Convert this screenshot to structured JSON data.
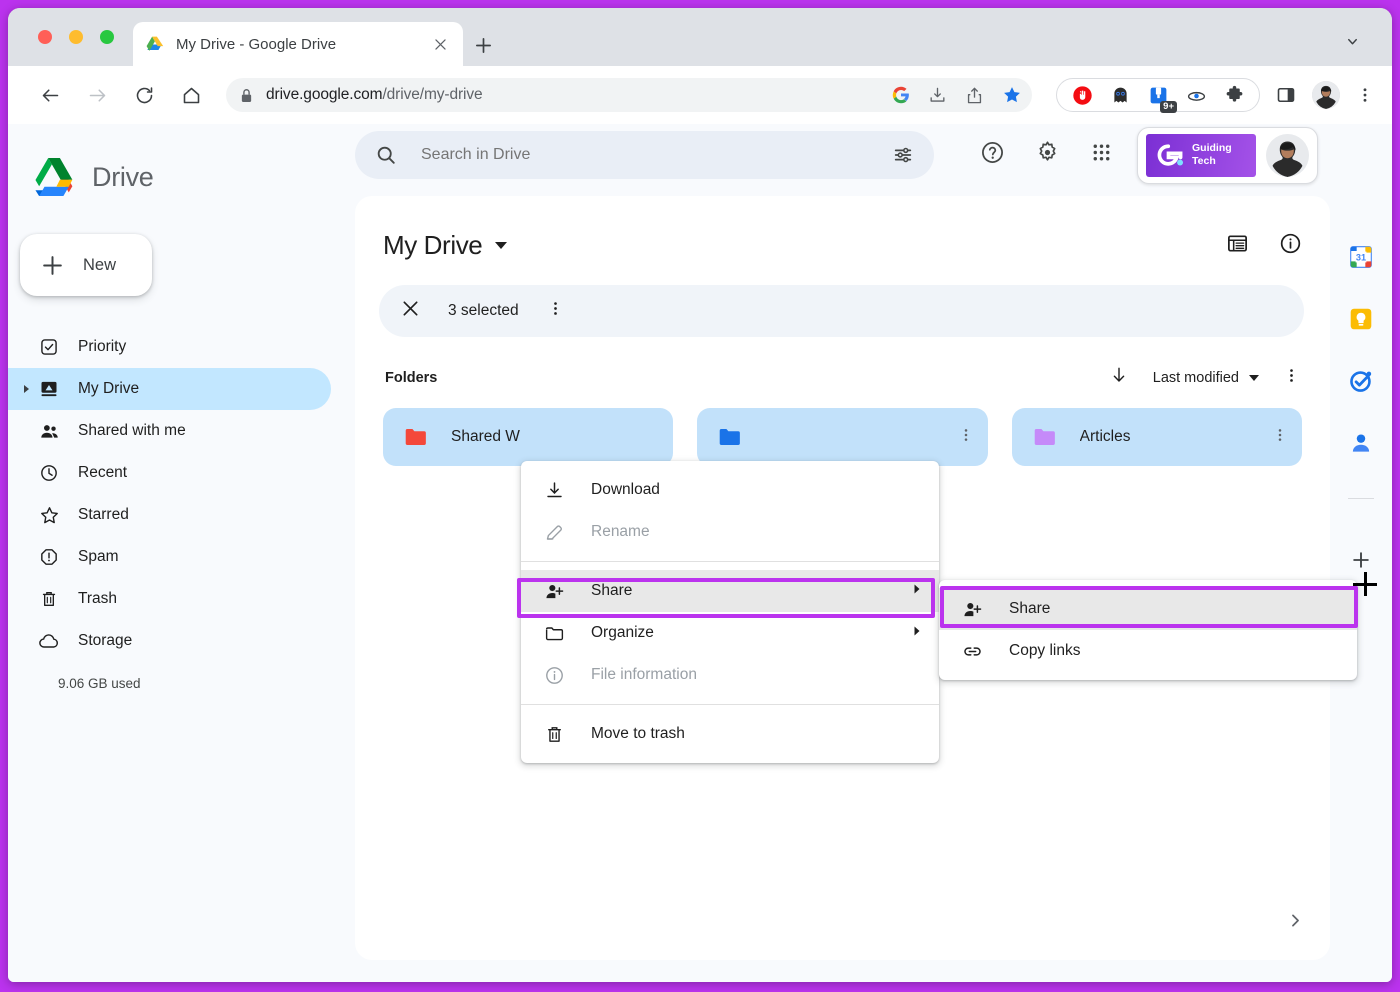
{
  "browser": {
    "tab": {
      "title": "My Drive - Google Drive",
      "favicon": "google-drive-favicon",
      "close": "×"
    },
    "new_tab_label": "+",
    "url": {
      "domain": "drive.google.com",
      "path": "/drive/my-drive"
    },
    "toolbar_icons": [
      "google-icon",
      "install-app-icon",
      "share-icon",
      "bookmark-star-icon"
    ],
    "extensions": [
      "adblock-icon",
      "ghostery-icon",
      "notes-extension-icon",
      "eye-extension-icon",
      "puzzle-extensions-icon"
    ],
    "extension_badge": "9+",
    "right_icons": [
      "side-panel-icon",
      "profile-avatar",
      "chrome-menu-icon"
    ]
  },
  "sidebar": {
    "brand": "Drive",
    "new_button": "New",
    "items": [
      {
        "label": "Priority",
        "icon": "priority-check-icon",
        "active": false
      },
      {
        "label": "My Drive",
        "icon": "my-drive-icon",
        "active": true
      },
      {
        "label": "Shared with me",
        "icon": "shared-people-icon",
        "active": false
      },
      {
        "label": "Recent",
        "icon": "clock-icon",
        "active": false
      },
      {
        "label": "Starred",
        "icon": "star-icon",
        "active": false
      },
      {
        "label": "Spam",
        "icon": "spam-alert-icon",
        "active": false
      },
      {
        "label": "Trash",
        "icon": "trash-icon",
        "active": false
      },
      {
        "label": "Storage",
        "icon": "cloud-icon",
        "active": false
      }
    ],
    "storage_used": "9.06 GB used"
  },
  "header": {
    "search_placeholder": "Search in Drive",
    "search_value": "",
    "filter_icon": "search-options-icon",
    "help_icon": "help-icon",
    "settings_icon": "gear-icon",
    "apps_icon": "apps-grid-icon",
    "badge_text_line1": "Guiding",
    "badge_text_line2": "Tech",
    "badge_logo": "GT",
    "avatar": "user-avatar"
  },
  "main": {
    "title": "My Drive",
    "view_icon": "list-view-icon",
    "info_icon": "info-icon",
    "selection": {
      "count_label": "3 selected",
      "close_icon": "close-icon",
      "more_icon": "more-vert-icon"
    },
    "section_title": "Folders",
    "sort": {
      "direction_icon": "arrow-down-icon",
      "label": "Last modified",
      "more_icon": "more-vert-icon"
    },
    "folders": [
      {
        "name": "Shared W",
        "color": "#f4483a",
        "selected": true
      },
      {
        "name": "",
        "color": "#1a73e8",
        "selected": true
      },
      {
        "name": "Articles",
        "color": "#c58af9",
        "selected": true
      }
    ],
    "expand_chevron": "chevron-right-icon"
  },
  "context_menu": {
    "items": [
      {
        "label": "Download",
        "icon": "download-icon",
        "disabled": false,
        "submenu": false,
        "highlighted": false
      },
      {
        "label": "Rename",
        "icon": "rename-pencil-icon",
        "disabled": true,
        "submenu": false,
        "highlighted": false
      },
      {
        "separator_after": false
      }
    ],
    "group1": [
      {
        "label": "Download",
        "icon": "download-icon",
        "disabled": false,
        "submenu": false,
        "highlighted": false
      },
      {
        "label": "Rename",
        "icon": "rename-pencil-icon",
        "disabled": true,
        "submenu": false,
        "highlighted": false
      }
    ],
    "group2": [
      {
        "label": "Share",
        "icon": "person-add-icon",
        "disabled": false,
        "submenu": true,
        "highlighted": true
      },
      {
        "label": "Organize",
        "icon": "folder-move-icon",
        "disabled": false,
        "submenu": true,
        "highlighted": false
      },
      {
        "label": "File information",
        "icon": "info-circle-icon",
        "disabled": true,
        "submenu": false,
        "highlighted": false
      }
    ],
    "group3": [
      {
        "label": "Move to trash",
        "icon": "trash-icon",
        "disabled": false,
        "submenu": false,
        "highlighted": false
      }
    ]
  },
  "submenu": {
    "items": [
      {
        "label": "Share",
        "icon": "person-add-icon",
        "highlighted": true
      },
      {
        "label": "Copy links",
        "icon": "link-icon",
        "highlighted": false
      }
    ]
  },
  "rail": {
    "items": [
      {
        "name": "google-calendar-icon"
      },
      {
        "name": "google-keep-icon"
      },
      {
        "name": "google-tasks-icon"
      },
      {
        "name": "google-contacts-icon"
      }
    ],
    "add_label": "+"
  },
  "colors": {
    "annotation_purple": "#bb33ee",
    "selected_card_blue": "#c2e1fa",
    "active_nav_blue": "#c2e7ff",
    "menu_highlight_gray": "#e8e8e8"
  }
}
